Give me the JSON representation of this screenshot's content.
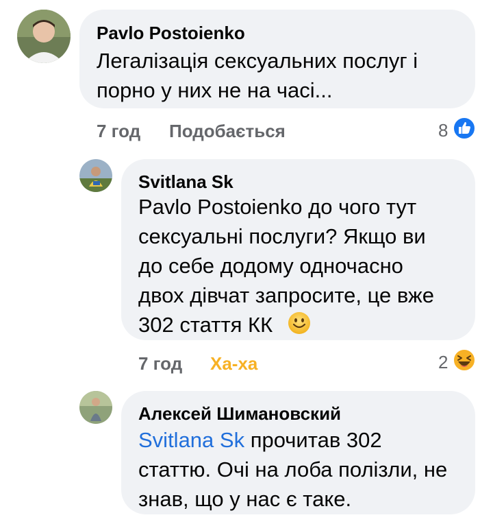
{
  "comments": [
    {
      "author": "Pavlo Postoienko",
      "lines": [
        "Легалізація сексуальних послуг і",
        "порно у них не на часі..."
      ],
      "time": "7 год",
      "action": "Подобається",
      "reaction_count": "8",
      "reaction_icon": "like-icon",
      "reaction_color": "#1877f2"
    },
    {
      "author": "Svitlana Sk",
      "lines": [
        "Pavlo Postoienko до чого тут",
        "сексуальні послуги? Якщо ви",
        "до себе додому одночасно",
        "двох дівчат запросите, це вже",
        "302 стаття КК"
      ],
      "emoji": "smile-emoji-icon",
      "time": "7 год",
      "action": "Ха-ха",
      "reaction_count": "2",
      "reaction_icon": "haha-icon",
      "reaction_color": "#f7b125"
    },
    {
      "author": "Алексей Шимановский",
      "mention": "Svitlana Sk",
      "lines": [
        " прочитав 302",
        "статтю. Очі на лоба полізли, не",
        "знав, що у нас є таке."
      ]
    }
  ],
  "colors": {
    "bubble": "#f0f2f5",
    "meta_text": "#65676b",
    "mention": "#216fdb"
  }
}
